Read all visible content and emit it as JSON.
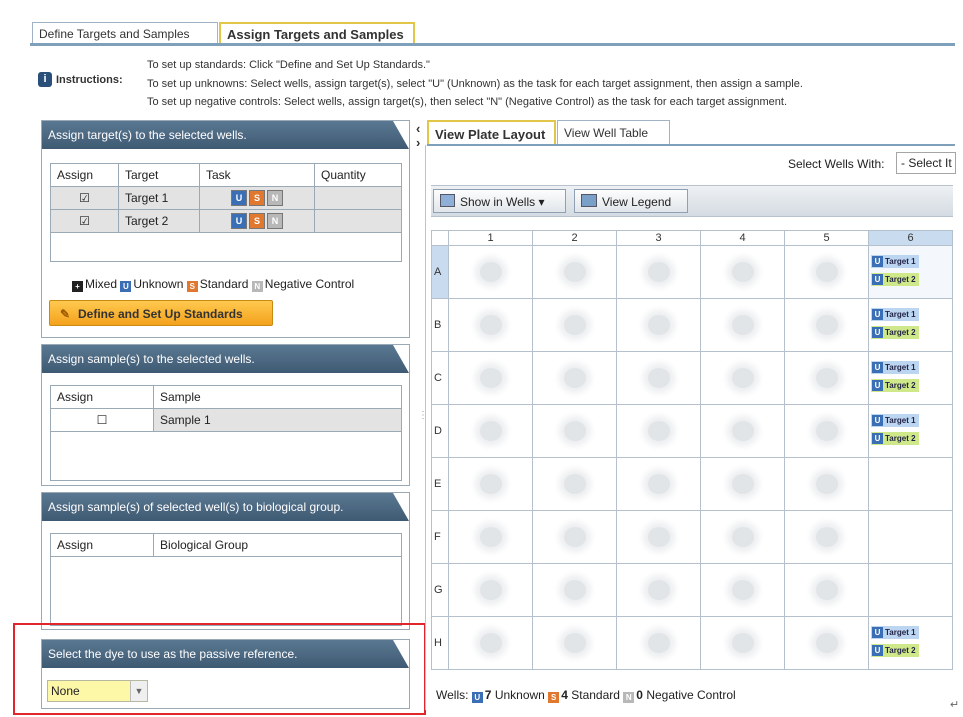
{
  "tabs": [
    {
      "label": "Define Targets and Samples"
    },
    {
      "label": "Assign Targets and Samples"
    }
  ],
  "instructions": {
    "label": "Instructions:",
    "lines": [
      "To set up standards: Click \"Define and Set Up Standards.\"",
      "To set up unknowns: Select wells, assign target(s), select \"U\" (Unknown) as the task for each target assignment, then assign a sample.",
      "To set up negative controls: Select wells, assign target(s), then select \"N\" (Negative Control) as the task for each target assignment."
    ]
  },
  "targets_panel": {
    "title": "Assign target(s) to the selected wells.",
    "columns": [
      "Assign",
      "Target",
      "Task",
      "Quantity"
    ],
    "rows": [
      {
        "checked": "☑",
        "target": "Target 1",
        "quantity": ""
      },
      {
        "checked": "☑",
        "target": "Target 2",
        "quantity": ""
      }
    ],
    "task_buttons": [
      "U",
      "S",
      "N"
    ],
    "legend": [
      {
        "label": "Mixed",
        "glyph": "+",
        "color": "#222222"
      },
      {
        "label": "Unknown",
        "glyph": "U",
        "color": "#3b6fb5"
      },
      {
        "label": "Standard",
        "glyph": "S",
        "color": "#e07830"
      },
      {
        "label": "Negative Control",
        "glyph": "N",
        "color": "#b8b8b8"
      }
    ],
    "button": "Define and Set Up Standards",
    "button_icon": "standards-wand-icon"
  },
  "samples_panel": {
    "title": "Assign sample(s) to the selected wells.",
    "columns": [
      "Assign",
      "Sample"
    ],
    "rows": [
      {
        "checked": "☐",
        "sample": "Sample 1"
      }
    ]
  },
  "bio_panel": {
    "title": "Assign sample(s) of selected well(s) to biological group.",
    "columns": [
      "Assign",
      "Biological Group"
    ]
  },
  "dye_panel": {
    "title": "Select the dye to use as the passive reference.",
    "value": "None"
  },
  "right_tabs": [
    {
      "label": "View Plate Layout"
    },
    {
      "label": "View Well Table"
    }
  ],
  "select_wells": {
    "label": "Select Wells With:",
    "value": "- Select It"
  },
  "toolbar": {
    "show_in_wells": "Show in Wells",
    "view_legend": "View Legend"
  },
  "plate": {
    "columns": [
      "1",
      "2",
      "3",
      "4",
      "5",
      "6"
    ],
    "rows": [
      "A",
      "B",
      "C",
      "D",
      "E",
      "F",
      "G",
      "H"
    ],
    "target_labels": [
      "Target 1",
      "Target 2"
    ],
    "assigned_col6_rows": [
      "A",
      "B",
      "C",
      "D",
      "H"
    ],
    "selected": {
      "row": "A",
      "column": "6"
    }
  },
  "well_summary": {
    "prefix": "Wells:",
    "unknown_count": "7",
    "unknown_label": "Unknown",
    "standard_count": "4",
    "standard_label": "Standard",
    "negative_count": "0",
    "negative_label": "Negative Control"
  },
  "colors": {
    "panel_header": "#4b6880",
    "accent_tab": "#e2c64a",
    "unknown": "#3b6fb5",
    "standard": "#e07830",
    "negative": "#b8b8b8",
    "highlight": "#e0262a"
  }
}
